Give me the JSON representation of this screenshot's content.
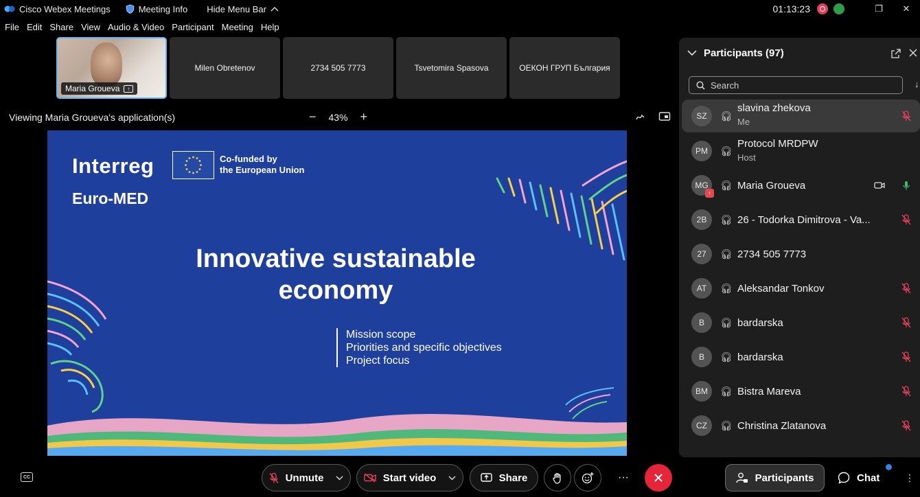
{
  "titlebar": {
    "app_name": "Cisco Webex Meetings",
    "meeting_info": "Meeting Info",
    "hide_menu": "Hide Menu Bar",
    "timer": "01:13:23"
  },
  "menu": [
    "File",
    "Edit",
    "Share",
    "View",
    "Audio & Video",
    "Participant",
    "Meeting",
    "Help"
  ],
  "thumbnails": {
    "active_name": "Maria Groueva",
    "others": [
      "Milen Obretenov",
      "2734 505 7773",
      "Tsvetomira Spasova",
      "ОЕКОН ГРУП България"
    ]
  },
  "viewing": {
    "label": "Viewing Maria Groueva's application(s)",
    "zoom": "43%",
    "zoom_out": "−",
    "zoom_in": "+"
  },
  "slide": {
    "logo": "Interreg",
    "program": "Euro-MED",
    "eu_line1": "Co-funded by",
    "eu_line2": "the European Union",
    "title_line1": "Innovative sustainable",
    "title_line2": "economy",
    "bullets": [
      "Mission scope",
      "Priorities and specific objectives",
      "Project focus"
    ]
  },
  "participants_panel": {
    "title": "Participants (97)",
    "search_placeholder": "Search",
    "list": [
      {
        "initials": "SZ",
        "name": "slavina zhekova",
        "role": "Me",
        "muted": true
      },
      {
        "initials": "PM",
        "name": "Protocol MRDPW",
        "role": "Host",
        "muted": false
      },
      {
        "initials": "MG",
        "name": "Maria Groueva",
        "role": "",
        "muted": false,
        "video": true,
        "sharing": true
      },
      {
        "initials": "2B",
        "name": "26 - Todorka Dimitrova - Va...",
        "role": "",
        "muted": true
      },
      {
        "initials": "27",
        "name": "2734 505 7773",
        "role": "",
        "muted": false
      },
      {
        "initials": "AT",
        "name": "Aleksandar Tonkov",
        "role": "",
        "muted": true
      },
      {
        "initials": "B",
        "name": "bardarska",
        "role": "",
        "muted": true
      },
      {
        "initials": "B",
        "name": "bardarska",
        "role": "",
        "muted": true
      },
      {
        "initials": "BM",
        "name": "Bistra Mareva",
        "role": "",
        "muted": true
      },
      {
        "initials": "CZ",
        "name": "Christina Zlatanova",
        "role": "",
        "muted": true
      }
    ]
  },
  "toolbar": {
    "unmute": "Unmute",
    "start_video": "Start video",
    "share": "Share",
    "participants": "Participants",
    "chat": "Chat"
  },
  "colors": {
    "slide_bg": "#1f3f9c",
    "end_call": "#e5253a",
    "muted_mic": "#e0405a",
    "active_border": "#64b5f6"
  }
}
